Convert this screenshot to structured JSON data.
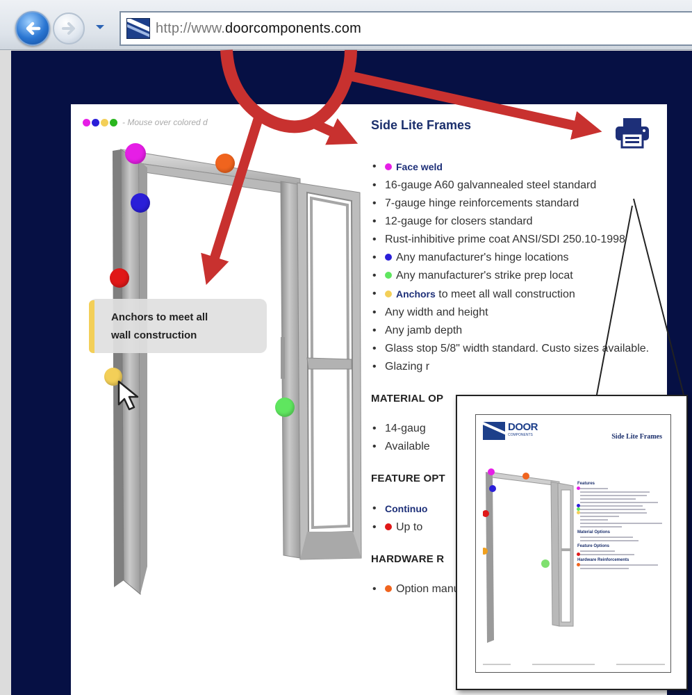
{
  "browser": {
    "url_prefix": "http://www.",
    "url_host": "doorcomponents.com"
  },
  "legend": {
    "dot_colors": [
      "#e61ee6",
      "#2a1ed8",
      "#f3cf58",
      "#2ab61e"
    ],
    "text": "- Mouse over colored d"
  },
  "tooltip": {
    "line1": "Anchors to meet all",
    "line2": "wall construction"
  },
  "content": {
    "title": "Side Lite Frames",
    "features": [
      {
        "dot": "#e61ee6",
        "link": "Face weld",
        "text": ""
      },
      {
        "dot": "",
        "link": "",
        "text": "16-gauge A60 galvannealed steel standard"
      },
      {
        "dot": "",
        "link": "",
        "text": "7-gauge hinge reinforcements standard"
      },
      {
        "dot": "",
        "link": "",
        "text": "12-gauge for closers standard"
      },
      {
        "dot": "",
        "link": "",
        "text": "Rust-inhibitive prime coat ANSI/SDI 250.10-1998"
      },
      {
        "dot": "#2a1ed8",
        "link": "",
        "text": "Any manufacturer's hinge locations"
      },
      {
        "dot": "#5fe65f",
        "link": "",
        "text": "Any manufacturer's strike prep locat"
      },
      {
        "dot": "#f3cf58",
        "link": "Anchors",
        "text": " to meet all wall construction"
      },
      {
        "dot": "",
        "link": "",
        "text": "Any width and height"
      },
      {
        "dot": "",
        "link": "",
        "text": "Any jamb depth"
      },
      {
        "dot": "",
        "link": "",
        "text": "Glass stop 5/8\" width standard. Custo sizes available."
      },
      {
        "dot": "",
        "link": "",
        "text": "Glazing r"
      }
    ],
    "material_heading": "MATERIAL OP",
    "material": [
      {
        "dot": "",
        "link": "",
        "text": "14-gaug"
      },
      {
        "dot": "",
        "link": "",
        "text": "Available"
      }
    ],
    "feature_heading": "FEATURE OPT",
    "feature_opts": [
      {
        "dot": "",
        "link": "Continuo",
        "text": ""
      },
      {
        "dot": "#e01818",
        "link": "",
        "text": "Up to"
      }
    ],
    "hardware_heading": "HARDWARE R",
    "hardware": [
      {
        "dot": "#f0641e",
        "link": "",
        "text": "Option manufac"
      }
    ]
  },
  "hotspots": [
    {
      "name": "magenta",
      "color": "#e61ee6"
    },
    {
      "name": "orange",
      "color": "#f0641e"
    },
    {
      "name": "blue",
      "color": "#2a1ed8"
    },
    {
      "name": "red",
      "color": "#e01818"
    },
    {
      "name": "yellow",
      "color": "#f3cf58"
    },
    {
      "name": "green",
      "color": "#5fe65f"
    }
  ],
  "icons": {
    "back": "back-arrow-icon",
    "forward": "forward-arrow-icon",
    "history": "chevron-down-icon",
    "print": "printer-icon",
    "cursor": "mouse-pointer-icon"
  },
  "preview": {
    "logo_text": "DOOR",
    "logo_sub": "COMPONENTS",
    "title": "Side Lite Frames",
    "headings": [
      "Features",
      "Material Options",
      "Feature Options",
      "Hardware Reinforcements"
    ]
  },
  "colors": {
    "page_background": "#061044",
    "heading_blue": "#1b2f6c",
    "arrow_red": "#c8312f"
  }
}
